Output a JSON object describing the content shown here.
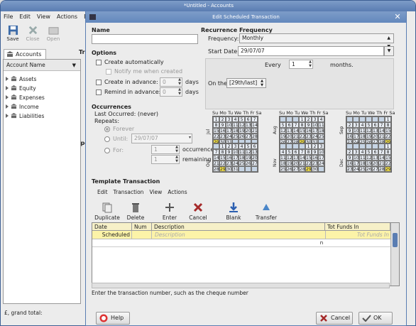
{
  "main": {
    "title": "*Untitled - Accounts",
    "menu": [
      "File",
      "Edit",
      "View",
      "Actions",
      "B"
    ],
    "toolbar": {
      "save": "Save",
      "close": "Close",
      "open": "Open"
    },
    "tab_label": "Accounts",
    "tree_header": "Account Name",
    "accounts": [
      "Assets",
      "Equity",
      "Expenses",
      "Income",
      "Liabilities"
    ],
    "grand_total": "£, grand total:",
    "transactions_label": "Tra",
    "upcoming_label": "Upc",
    "side_labels": [
      "Jul",
      "Sep",
      "Oct"
    ]
  },
  "dialog": {
    "title": "Edit Scheduled Transaction",
    "name_label": "Name",
    "name_value": "",
    "options": {
      "header": "Options",
      "create_auto": "Create automatically",
      "notify": "Notify me when created",
      "create_adv": "Create in advance:",
      "remind_adv": "Remind in advance:",
      "create_adv_val": "0",
      "remind_adv_val": "0",
      "days": "days"
    },
    "occurrences": {
      "header": "Occurrences",
      "last": "Last Occurred: (never)",
      "repeats": "Repeats:",
      "forever": "Forever",
      "until": "Until:",
      "until_val": "29/07/07",
      "for": "For:",
      "for_val": "1",
      "rem_val": "1",
      "occ_label": "occurrences",
      "rem_label": "remaining"
    },
    "recurrence": {
      "header": "Recurrence Frequency",
      "freq_label": "Frequency:",
      "freq_val": "Monthly",
      "start_label": "Start Date:",
      "start_val": "29/07/07",
      "every_label": "Every",
      "every_val": "1",
      "months_label": "months.",
      "on_the": "On the",
      "on_val": "[29th/last]"
    },
    "cal_days": "Su Mo Tu We Th Fr Sa",
    "calendars": [
      {
        "name": "Jul",
        "first": 0,
        "len": 31,
        "sel": [
          29
        ]
      },
      {
        "name": "Aug",
        "first": 3,
        "len": 31,
        "sel": [
          29
        ]
      },
      {
        "name": "Sep",
        "first": 6,
        "len": 30,
        "sel": [
          29
        ]
      },
      {
        "name": "Oct",
        "first": 1,
        "len": 31,
        "sel": [
          29
        ]
      },
      {
        "name": "Nov",
        "first": 4,
        "len": 30,
        "sel": [
          29
        ]
      },
      {
        "name": "Dec",
        "first": 6,
        "len": 31,
        "sel": [
          29
        ]
      }
    ],
    "template": {
      "header": "Template Transaction",
      "menu": [
        "Edit",
        "Transaction",
        "View",
        "Actions"
      ],
      "buttons": [
        "Duplicate",
        "Delete",
        "Enter",
        "Cancel",
        "Blank",
        "Transfer"
      ],
      "cols": [
        "Date",
        "Num",
        "Description",
        "Tot Funds In"
      ],
      "row_date": "Scheduled",
      "row_desc": "Description",
      "row_funds": "Tot Funds In",
      "row2_flag": "n"
    },
    "status": "Enter the transaction number, such as the cheque number",
    "help": "Help",
    "cancel": "Cancel",
    "ok": "OK"
  }
}
